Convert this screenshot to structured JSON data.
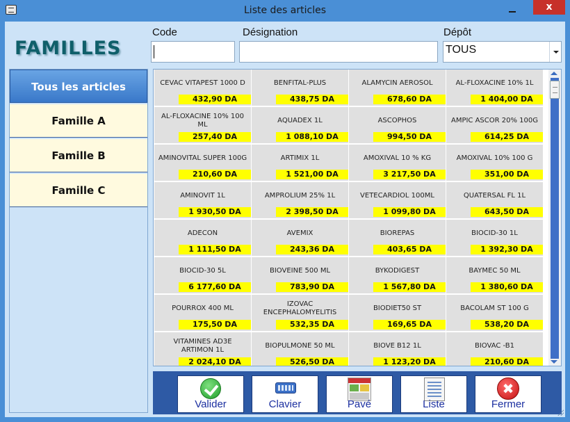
{
  "window": {
    "title": "Liste des articles",
    "close_glyph": "x"
  },
  "families_title": "FAMILLES",
  "filters": {
    "code_label": "Code",
    "code_value": "",
    "designation_label": "Désignation",
    "designation_value": "",
    "depot_label": "Dépôt",
    "depot_value": "TOUS"
  },
  "sidebar": {
    "items": [
      {
        "label": "Tous les articles",
        "active": true
      },
      {
        "label": "Famille A",
        "active": false
      },
      {
        "label": "Famille B",
        "active": false
      },
      {
        "label": "Famille C",
        "active": false
      }
    ]
  },
  "articles": [
    {
      "name": "CEVAC VITAPEST 1000 D",
      "price": "432,90 DA"
    },
    {
      "name": "BENFITAL-PLUS",
      "price": "438,75 DA"
    },
    {
      "name": "ALAMYCIN AEROSOL",
      "price": "678,60 DA"
    },
    {
      "name": "AL-FLOXACINE 10% 1L",
      "price": "1 404,00 DA"
    },
    {
      "name": "AL-FLOXACINE 10% 100 ML",
      "price": "257,40 DA"
    },
    {
      "name": "AQUADEX 1L",
      "price": "1 088,10 DA"
    },
    {
      "name": "ASCOPHOS",
      "price": "994,50 DA"
    },
    {
      "name": "AMPIC ASCOR 20% 100G",
      "price": "614,25 DA"
    },
    {
      "name": "AMINOVITAL SUPER 100G",
      "price": "210,60 DA"
    },
    {
      "name": "ARTIMIX 1L",
      "price": "1 521,00 DA"
    },
    {
      "name": "AMOXIVAL 10 % KG",
      "price": "3 217,50 DA"
    },
    {
      "name": "AMOXIVAL 10% 100 G",
      "price": "351,00 DA"
    },
    {
      "name": "AMINOVIT 1L",
      "price": "1 930,50 DA"
    },
    {
      "name": "AMPROLIUM 25% 1L",
      "price": "2 398,50 DA"
    },
    {
      "name": "VETECARDIOL 100ML",
      "price": "1 099,80 DA"
    },
    {
      "name": "QUATERSAL FL 1L",
      "price": "643,50 DA"
    },
    {
      "name": "ADECON",
      "price": "1 111,50 DA"
    },
    {
      "name": "AVEMIX",
      "price": "243,36 DA"
    },
    {
      "name": "BIOREPAS",
      "price": "403,65 DA"
    },
    {
      "name": "BIOCID-30 1L",
      "price": "1 392,30 DA"
    },
    {
      "name": "BIOCID-30 5L",
      "price": "6 177,60 DA"
    },
    {
      "name": "BIOVEINE 500 ML",
      "price": "783,90 DA"
    },
    {
      "name": "BYKODIGEST",
      "price": "1 567,80 DA"
    },
    {
      "name": "BAYMEC 50 ML",
      "price": "1 380,60 DA"
    },
    {
      "name": "POURROX 400 ML",
      "price": "175,50 DA"
    },
    {
      "name": "IZOVAC ENCEPHALOMYELITIS",
      "price": "532,35 DA"
    },
    {
      "name": "BIODIET50 ST",
      "price": "169,65 DA"
    },
    {
      "name": "BACOLAM ST 100 G",
      "price": "538,20 DA"
    },
    {
      "name": "VITAMINES AD3E ARTIMON 1L",
      "price": "2 024,10 DA"
    },
    {
      "name": "BIOPULMONE 50 ML",
      "price": "526,50 DA"
    },
    {
      "name": "BIOVE B12 1L",
      "price": "1 123,20 DA"
    },
    {
      "name": "BIOVAC -B1",
      "price": "210,60 DA"
    }
  ],
  "toolbar": {
    "valider": "Valider",
    "clavier": "Clavier",
    "pave": "Pavé",
    "liste": "Liste",
    "fermer": "Fermer",
    "fermer_glyph": "✖"
  },
  "colors": {
    "window_frame": "#4a8fd6",
    "client_bg": "#cde3f7",
    "price_highlight": "#ffff00",
    "toolbar_bg": "#2e5aa5",
    "title_teal": "#0f5f6a"
  }
}
